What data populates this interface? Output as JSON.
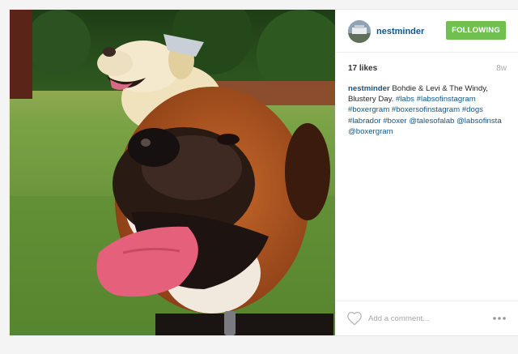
{
  "post": {
    "username": "nestminder",
    "follow_label": "FOLLOWING",
    "likes": "17 likes",
    "time_ago": "8w",
    "caption": {
      "username": "nestminder",
      "text": "Bohdie & Levi & The Windy, Blustery Day.",
      "hashtags": [
        "#labs",
        "#labsofinstagram",
        "#boxergram",
        "#boxersofinstagram",
        "#dogs",
        "#labrador",
        "#boxer",
        "@talesofalab",
        "@labsofinsta",
        "@boxergram"
      ]
    },
    "comment_placeholder": "Add a comment...",
    "icons": {
      "like": "heart-outline-icon",
      "more": "more-options-icon"
    },
    "colors": {
      "follow_button": "#70c050",
      "link": "#125688"
    }
  }
}
